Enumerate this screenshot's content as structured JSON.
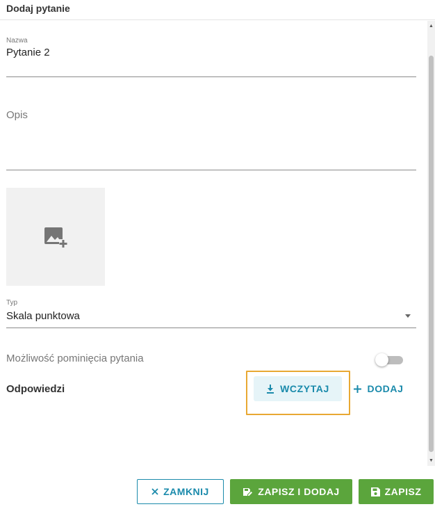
{
  "dialog": {
    "title": "Dodaj pytanie"
  },
  "form": {
    "name": {
      "label": "Nazwa",
      "value": "Pytanie 2"
    },
    "description": {
      "placeholder": "Opis"
    },
    "type": {
      "label": "Typ",
      "value": "Skala punktowa"
    },
    "skip": {
      "label": "Możliwość pominięcia pytania",
      "enabled": false
    },
    "answers": {
      "label": "Odpowiedzi",
      "load_label": "WCZYTAJ",
      "add_label": "DODAJ"
    }
  },
  "icons": {
    "image_placeholder": "add-photo-icon",
    "load": "download-icon",
    "add": "plus-icon",
    "close": "close-icon",
    "save_add": "save-edit-icon",
    "save": "save-icon"
  },
  "footer": {
    "close_label": "ZAMKNIJ",
    "save_add_label": "ZAPISZ I DODAJ",
    "save_label": "ZAPISZ"
  },
  "colors": {
    "accent": "#1a8aab",
    "save_green": "#5ba53c",
    "highlight": "#e8a833"
  }
}
